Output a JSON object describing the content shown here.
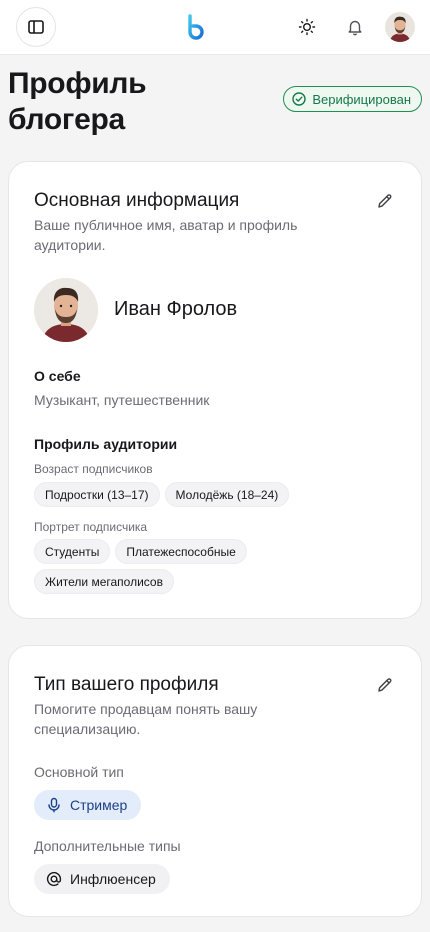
{
  "header": {
    "sidebar_icon": "sidebar-toggle-icon",
    "logo_icon": "brand-logo-icon",
    "theme_icon": "sun-icon",
    "notifications_icon": "bell-icon",
    "avatar_icon": "user-avatar"
  },
  "page": {
    "title": "Профиль блогера",
    "verified_label": "Верифицирован",
    "accent_color": "#1f8f54"
  },
  "basic_info": {
    "title": "Основная информация",
    "subtitle": "Ваше публичное имя, аватар и профиль аудитории.",
    "user_name": "Иван Фролов",
    "about_label": "О себе",
    "about_text": "Музыкант, путешественник",
    "audience_label": "Профиль аудитории",
    "age_label": "Возраст подписчиков",
    "age_chips": [
      "Подростки (13–17)",
      "Молодёжь (18–24)"
    ],
    "portrait_label": "Портрет подписчика",
    "portrait_chips": [
      "Студенты",
      "Платежеспособные",
      "Жители мегаполисов"
    ]
  },
  "profile_type": {
    "title": "Тип вашего профиля",
    "subtitle": "Помогите продавцам понять вашу специализацию.",
    "main_label": "Основной тип",
    "main_type": "Стример",
    "main_icon": "microphone-icon",
    "extra_label": "Дополнительные типы",
    "extra_type": "Инфлюенсер",
    "extra_icon": "at-sign-icon"
  }
}
